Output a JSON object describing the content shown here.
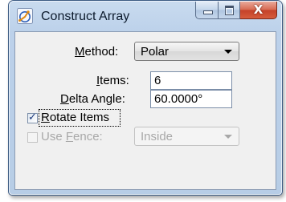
{
  "window": {
    "title": "Construct Array",
    "icon": "construct-array-icon"
  },
  "caption_buttons": {
    "minimize": "minimize-icon",
    "maximize": "maximize-icon",
    "close_glyph": "X"
  },
  "form": {
    "method": {
      "label_mnemonic": "M",
      "label_rest": "ethod:",
      "value": "Polar"
    },
    "items": {
      "label_pre": "",
      "label_mnemonic": "I",
      "label_rest": "tems:",
      "value": "6"
    },
    "delta_angle": {
      "label_mnemonic": "D",
      "label_rest": "elta Angle:",
      "value": "60.0000°"
    },
    "rotate_items": {
      "label_mnemonic": "R",
      "label_rest": "otate Items",
      "checked": true
    },
    "use_fence": {
      "label_pre": "Use ",
      "label_mnemonic": "F",
      "label_rest": "ence:",
      "checked": false,
      "enabled": false,
      "value": "Inside"
    }
  }
}
